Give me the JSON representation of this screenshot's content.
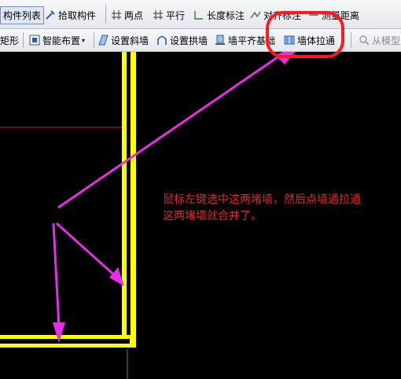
{
  "toolbar_row1": {
    "component_list": "构件列表",
    "pick_component": "拾取构件",
    "two_points": "两点",
    "parallel": "平行",
    "length_dim": "长度标注",
    "align_label": "对齐标注",
    "measure_distance": "测量距离"
  },
  "toolbar_row2": {
    "rectangle": "矩形",
    "smart_layout": "智能布置",
    "set_slope_wall": "设置斜墙",
    "set_arch_wall": "设置拱墙",
    "wall_flush": "墙平齐基础",
    "wall_extend": "墙体拉通",
    "from_model": "从模型"
  },
  "annotation": {
    "line1": "鼠标左键选中这两堵墙，然后点墙通拉通",
    "line2": "这两堵墙就合并了。"
  },
  "colors": {
    "wall_yellow": "#ffff00",
    "arrow_magenta": "#e62ee6",
    "note_red": "#e3262a",
    "highlight_red": "#ff1a1a"
  }
}
